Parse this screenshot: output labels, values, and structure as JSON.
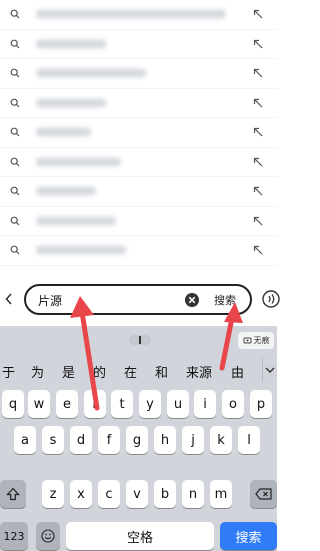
{
  "search": {
    "back_icon": "chevron-left",
    "query": "片源",
    "submit_label": "搜索",
    "clear_icon": "circle-x",
    "voice_icon": "voice-waves"
  },
  "suggestions": [
    {
      "icon": "search-icon",
      "action_icon": "fill-arrow-icon"
    },
    {
      "icon": "search-icon",
      "action_icon": "fill-arrow-icon"
    },
    {
      "icon": "search-icon",
      "action_icon": "fill-arrow-icon"
    },
    {
      "icon": "search-icon",
      "action_icon": "fill-arrow-icon"
    },
    {
      "icon": "search-icon",
      "action_icon": "fill-arrow-icon"
    },
    {
      "icon": "search-icon",
      "action_icon": "fill-arrow-icon"
    },
    {
      "icon": "search-icon",
      "action_icon": "fill-arrow-icon"
    },
    {
      "icon": "search-icon",
      "action_icon": "fill-arrow-icon"
    },
    {
      "icon": "search-icon",
      "action_icon": "fill-arrow-icon"
    }
  ],
  "keyboard": {
    "incognito_label": "无痕",
    "candidates": [
      "于",
      "为",
      "是",
      "的",
      "在",
      "和",
      "来源",
      "由"
    ],
    "row1": [
      "q",
      "w",
      "e",
      "r",
      "t",
      "y",
      "u",
      "i",
      "o",
      "p"
    ],
    "row2": [
      "a",
      "s",
      "d",
      "f",
      "g",
      "h",
      "j",
      "k",
      "l"
    ],
    "row3": [
      "z",
      "x",
      "c",
      "v",
      "b",
      "n",
      "m"
    ],
    "shift_icon": "shift-icon",
    "delete_icon": "backspace-icon",
    "num_label": "123",
    "emoji_icon": "emoji-icon",
    "space_label": "空格",
    "enter_label": "搜索"
  },
  "colors": {
    "accent": "#2f7cf6",
    "annotation_arrow": "#e8464a"
  }
}
